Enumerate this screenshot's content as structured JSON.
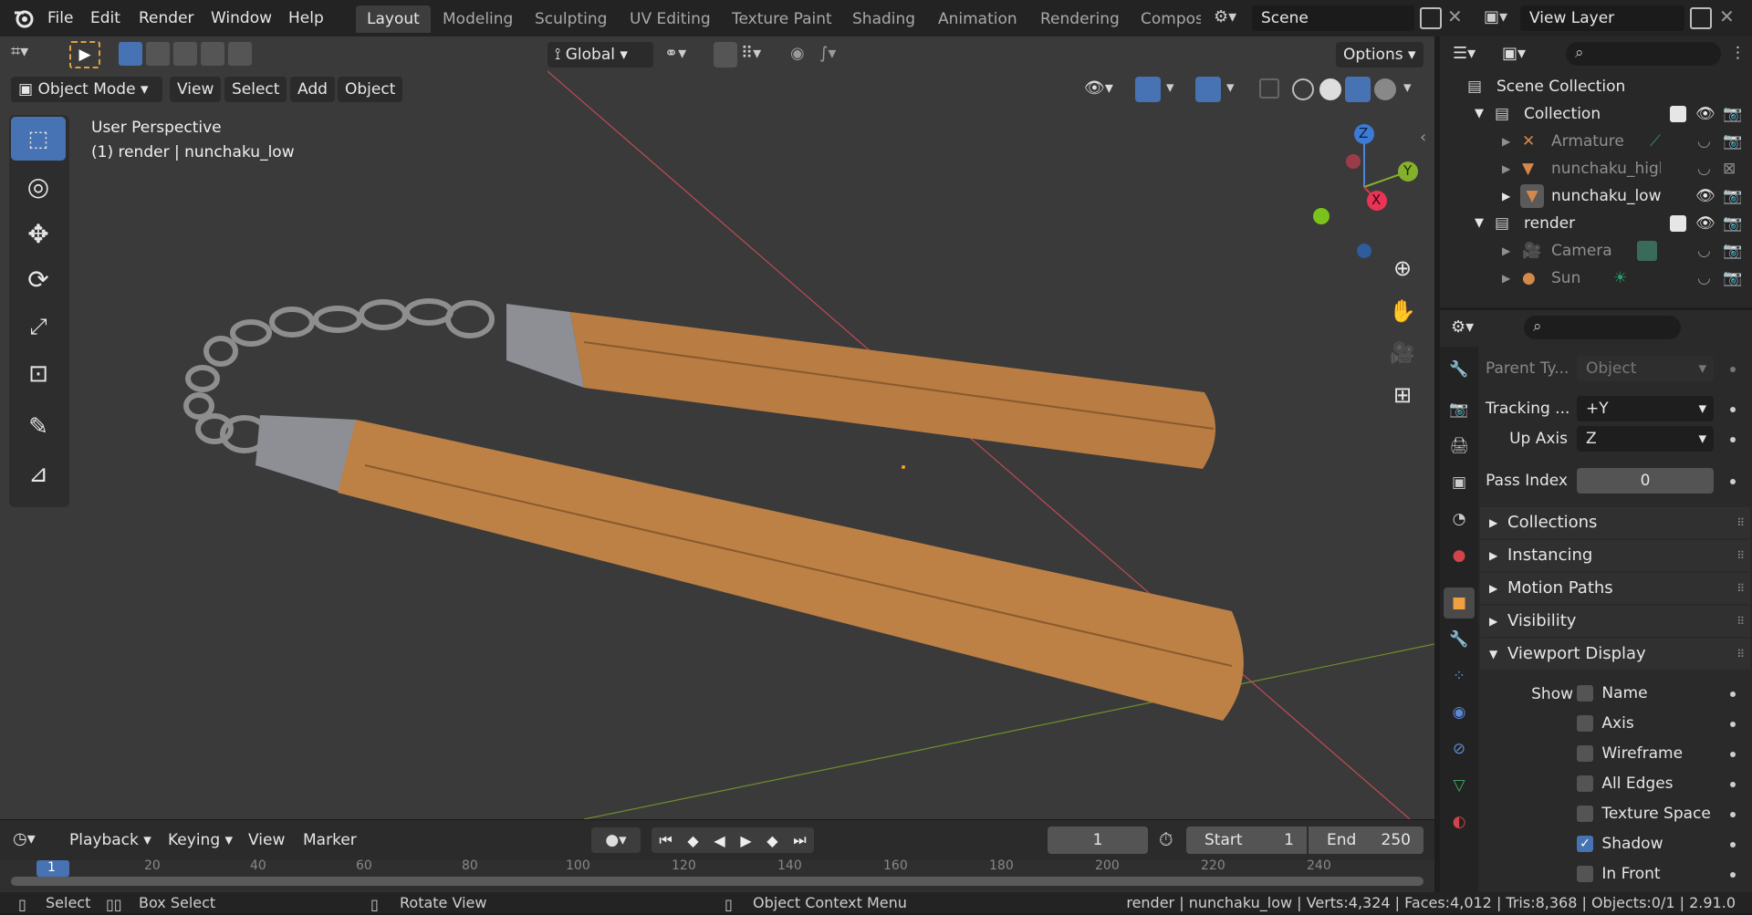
{
  "topbar": {
    "menu": [
      "File",
      "Edit",
      "Render",
      "Window",
      "Help"
    ],
    "workspaces": [
      "Layout",
      "Modeling",
      "Sculpting",
      "UV Editing",
      "Texture Paint",
      "Shading",
      "Animation",
      "Rendering",
      "Compos"
    ],
    "active_workspace": "Layout",
    "scene": "Scene",
    "view_layer": "View Layer"
  },
  "toolbar_header": {
    "transform_orientation": "Global",
    "options": "Options"
  },
  "viewport_header": {
    "mode": "Object Mode",
    "menus": [
      "View",
      "Select",
      "Add",
      "Object"
    ]
  },
  "viewport": {
    "perspective_label": "User Perspective",
    "object_label": "(1) render | nunchaku_low",
    "axis_labels": {
      "z": "Z",
      "y": "Y",
      "x": "X"
    }
  },
  "tools": [
    "select-box",
    "cursor",
    "move",
    "rotate",
    "scale",
    "transform",
    "annotate",
    "measure"
  ],
  "timeline": {
    "menus": [
      "Playback",
      "Keying",
      "View",
      "Marker"
    ],
    "current_frame": "1",
    "start_label": "Start",
    "start": "1",
    "end_label": "End",
    "end": "250",
    "ruler": [
      "1",
      "20",
      "40",
      "60",
      "80",
      "100",
      "120",
      "140",
      "160",
      "180",
      "200",
      "220",
      "240"
    ]
  },
  "statusbar": {
    "select": "Select",
    "box_select": "Box Select",
    "rotate_view": "Rotate View",
    "context_menu": "Object Context Menu",
    "info": "render | nunchaku_low | Verts:4,324 | Faces:4,012 | Tris:8,368 | Objects:0/1 | 2.91.0"
  },
  "outliner": {
    "root": "Scene Collection",
    "items": [
      {
        "label": "Collection",
        "level": 0,
        "type": "collection"
      },
      {
        "label": "Armature",
        "level": 1,
        "type": "armature"
      },
      {
        "label": "nunchaku_high",
        "level": 1,
        "type": "mesh"
      },
      {
        "label": "nunchaku_low",
        "level": 1,
        "type": "mesh"
      },
      {
        "label": "render",
        "level": 0,
        "type": "collection"
      },
      {
        "label": "Camera",
        "level": 1,
        "type": "camera"
      },
      {
        "label": "Sun",
        "level": 1,
        "type": "light"
      }
    ]
  },
  "properties": {
    "parent_type_label": "Parent Ty...",
    "parent_type_value": "Object",
    "tracking_label": "Tracking ...",
    "tracking_value": "+Y",
    "up_axis_label": "Up Axis",
    "up_axis_value": "Z",
    "pass_index_label": "Pass Index",
    "pass_index_value": "0",
    "panels": [
      "Collections",
      "Instancing",
      "Motion Paths",
      "Visibility",
      "Viewport Display"
    ],
    "show_label": "Show",
    "checkboxes": [
      {
        "label": "Name",
        "checked": false
      },
      {
        "label": "Axis",
        "checked": false
      },
      {
        "label": "Wireframe",
        "checked": false
      },
      {
        "label": "All Edges",
        "checked": false
      },
      {
        "label": "Texture Space",
        "checked": false
      },
      {
        "label": "Shadow",
        "checked": true
      },
      {
        "label": "In Front",
        "checked": false
      }
    ]
  }
}
